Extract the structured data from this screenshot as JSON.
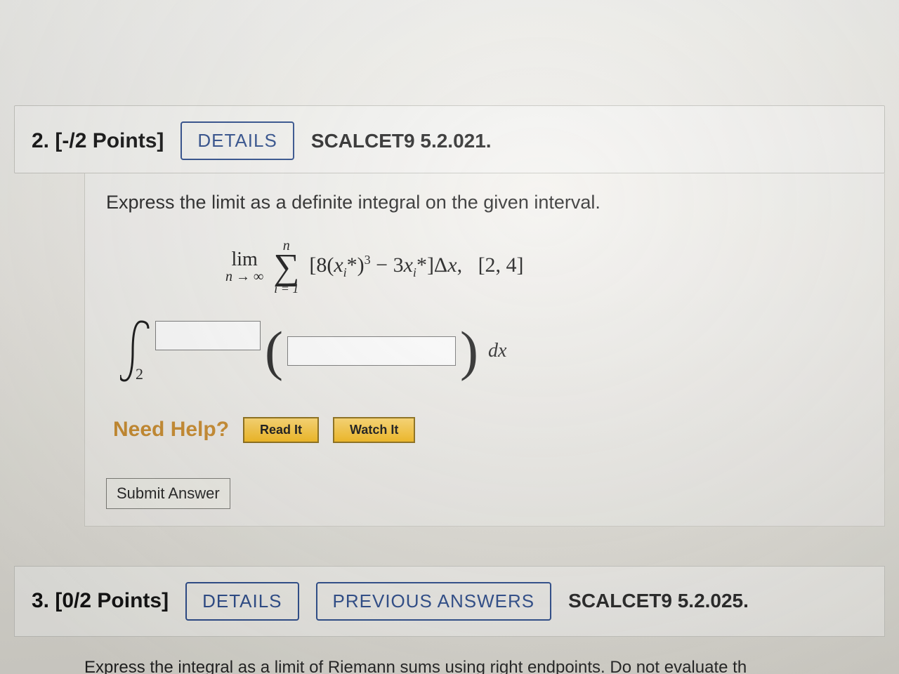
{
  "q2": {
    "num_label": "2.",
    "points": "[-/2 Points]",
    "details": "DETAILS",
    "source": "SCALCET9 5.2.021.",
    "prompt": "Express the limit as a definite integral on the given interval.",
    "math": {
      "lim": "lim",
      "lim_sub": "n → ∞",
      "sigma_top": "n",
      "sigma_bot": "i = 1",
      "summand": "[8(xᵢ*)³ − 3xᵢ*]Δx,",
      "interval": "[2, 4]"
    },
    "integral": {
      "lower": "2",
      "dx": "dx"
    },
    "help": {
      "label": "Need Help?",
      "read": "Read It",
      "watch": "Watch It"
    },
    "submit": "Submit Answer"
  },
  "q3": {
    "num_label": "3.",
    "points": "[0/2 Points]",
    "details": "DETAILS",
    "prev": "PREVIOUS ANSWERS",
    "source": "SCALCET9 5.2.025.",
    "cutoff_text": "Express the integral as a limit of Riemann sums using right endpoints. Do not evaluate th"
  }
}
